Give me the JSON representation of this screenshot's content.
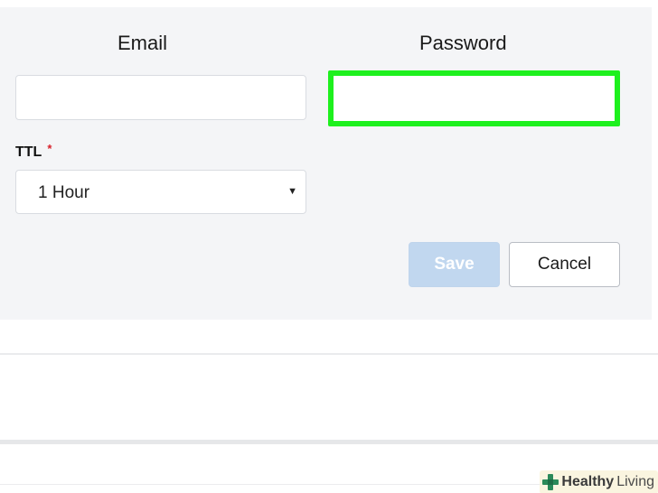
{
  "form": {
    "email_label": "Email",
    "email_value": "",
    "password_label": "Password",
    "password_value": "",
    "ttl_label": "TTL",
    "ttl_required_mark": "*",
    "ttl_selected": "1 Hour"
  },
  "buttons": {
    "save_label": "Save",
    "cancel_label": "Cancel"
  },
  "watermark": {
    "brand_part1": "Healthy",
    "brand_part2": "Living",
    "logo_icon": "plus-cross-icon"
  },
  "colors": {
    "highlight": "#1ef01e",
    "save_disabled": "#c1d7ef",
    "required": "#d8202a"
  }
}
